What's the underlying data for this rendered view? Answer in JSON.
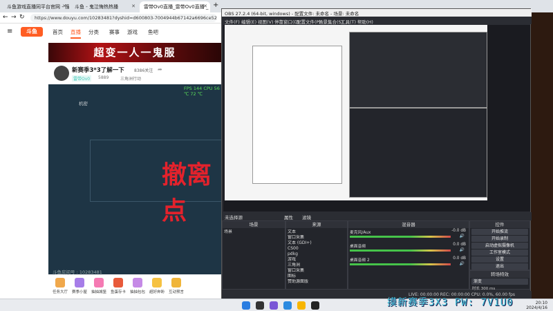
{
  "browser": {
    "tabs": [
      {
        "title": "斗鱼游戏直播同平台官网 - 搜索"
      },
      {
        "title": "斗鱼 - 鬼泣悔热热播"
      },
      {
        "title": "雷带Ov0直播_雷带Ov0直播 _ 斗"
      }
    ],
    "new_tab": "+",
    "url": "https://www.douyu.com/10283481?dyshid=d600803-7004944b67142a6696ce52e000061601",
    "nav": {
      "logo": "斗鱼",
      "items": [
        "首页",
        "直播",
        "分类",
        "赛事",
        "游戏",
        "鱼吧"
      ],
      "active": "直播"
    },
    "banner_text": "超变一人一鬼服",
    "streamer": {
      "title": "新赛季3*3了解一下",
      "followers": "8386关注",
      "name": "雷带Ov0",
      "hot": "5889",
      "category": "三角洲行动"
    },
    "player": {
      "hud": "FPS 144 CPU 56 ℃ 72 ℃",
      "corner_label": "机密",
      "big_text": "撤离点",
      "room_label": "斗鱼房间号 : 10283481"
    },
    "gifts": [
      {
        "label": "任务大厅"
      },
      {
        "label": "赛季小屋"
      },
      {
        "label": "抽抽城堡"
      },
      {
        "label": "鱼蛋存卡"
      },
      {
        "label": "抽抽包包"
      },
      {
        "label": "超好奔盼"
      },
      {
        "label": "互动预言"
      }
    ]
  },
  "obs": {
    "title": "OBS 27.2.4 (64-bit, windows) - 配置文件: 未命名 - 场景: 未命名",
    "menu": [
      "文件(F)",
      "编辑(E)",
      "视图(V)",
      "停靠窗口(D)",
      "配置文件(P)",
      "场景集合(S)",
      "工具(T)",
      "帮助(H)"
    ],
    "scene_bar": {
      "label": "未选择源",
      "prop": "属性",
      "filter": "滤镜"
    },
    "scenes": {
      "header": "场景",
      "items": [
        "场景"
      ]
    },
    "sources": {
      "header": "来源",
      "items": [
        "文本",
        "窗口采集",
        "文本 (GDI+)",
        "CS00",
        "pdkg",
        "游戏",
        "三角洲",
        "窗口采集",
        "图标",
        "赞助源面版"
      ]
    },
    "mixer": {
      "header": "混音器",
      "channels": [
        {
          "name": "麦克风/Aux",
          "db": "-0.0 dB"
        },
        {
          "name": "桌面音频",
          "db": "0.0 dB"
        },
        {
          "name": "桌面音频 2",
          "db": "0.0 dB"
        }
      ]
    },
    "controls": {
      "header": "控件",
      "buttons": [
        "开始推流",
        "开始录制",
        "启动虚拟摄像机",
        "工作室模式",
        "设置",
        "退出"
      ]
    },
    "transitions": {
      "header": "转场特效",
      "mode": "渐变",
      "duration_label": "时长",
      "duration": "300 ms"
    },
    "status": "LIVE: 00:00:00  REC: 00:00:00  CPU: 0.0%, 60.00 fps"
  },
  "overlay_text": "摸新赛季3X3 PW: 7V1U0",
  "taskbar": {
    "time": "20:10",
    "date": "2024/4/16"
  }
}
